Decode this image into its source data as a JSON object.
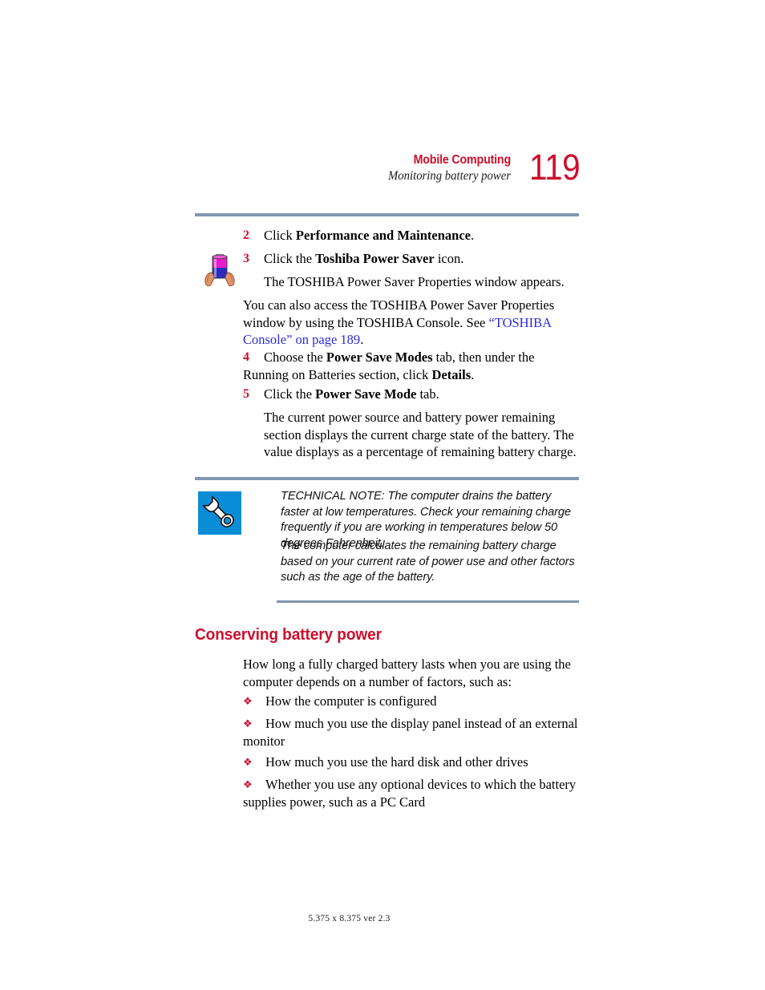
{
  "header": {
    "chapter": "Mobile Computing",
    "section": "Monitoring battery power",
    "page_number": "119",
    "chapter_color": "#CE0E2D",
    "rule_color": "#8196B0"
  },
  "steps": [
    {
      "number": "2",
      "pre": "Click ",
      "bold": "Performance and Maintenance",
      "post": "."
    },
    {
      "number": "3",
      "pre": "Click the ",
      "bold": "Toshiba Power Saver",
      "post": " icon."
    },
    {
      "number": "4",
      "pre": "Choose the ",
      "bold": "Power Save Modes",
      "mid": " tab, then under the Running on Batteries section, click ",
      "bold2": "Details",
      "post": "."
    },
    {
      "number": "5",
      "pre": "Click the ",
      "bold": "Power Save Mode",
      "post": " tab."
    }
  ],
  "paragraphs": {
    "after_step3": "The TOSHIBA Power Saver Properties window appears.",
    "access_note_pre": "You can also access the TOSHIBA Power Saver Properties window by using the TOSHIBA Console. See ",
    "access_note_link": "“TOSHIBA Console” on page 189",
    "access_note_post": ".",
    "after_step5": "The current power source and battery power remaining section displays the current charge state of the battery. The value displays as a percentage of remaining battery charge."
  },
  "technical_note": {
    "icon": "wrench-icon",
    "icon_bg_color": "#0A8DD6",
    "paragraph_1": "TECHNICAL NOTE: The computer drains the battery faster at low temperatures. Check your remaining charge frequently if you are working in temperatures below 50 degrees Fahrenheit.",
    "paragraph_2": "The computer calculates the remaining battery charge based on your current rate of power use and other factors such as the age of the battery."
  },
  "margin_icon": {
    "name": "battery-in-hands-icon",
    "battery_top_color": "#E81CCB",
    "battery_bottom_color": "#2B2BBF",
    "hand_color": "#E0946B"
  },
  "section": {
    "heading": "Conserving battery power",
    "intro": "How long a fully charged battery lasts when you are using the computer depends on a number of factors, such as:",
    "bullet_mark": "❖",
    "bullets": [
      "How the computer is configured",
      "How much you use the display panel instead of an external monitor",
      "How much you use the hard disk and other drives",
      "Whether you use any optional devices to which the battery supplies power, such as a PC Card"
    ]
  },
  "footer": {
    "text": "5.375 x 8.375 ver 2.3"
  }
}
